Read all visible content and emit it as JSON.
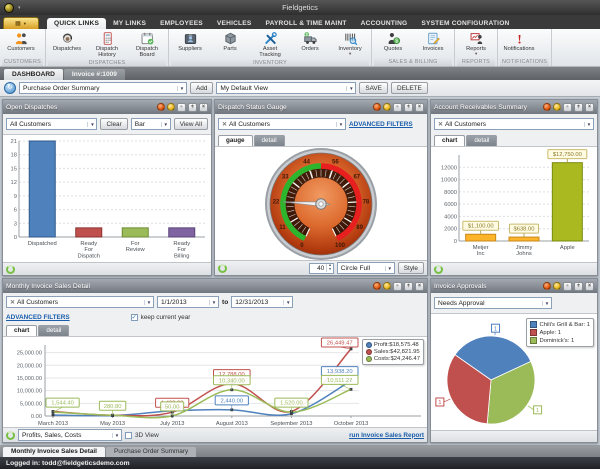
{
  "window": {
    "title": "Fieldgetics"
  },
  "ribbon": {
    "tabs": [
      {
        "label": "QUICK LINKS",
        "active": true
      },
      {
        "label": "MY LINKS"
      },
      {
        "label": "EMPLOYEES"
      },
      {
        "label": "VEHICLES"
      },
      {
        "label": "PAYROLL & TIME MAINT"
      },
      {
        "label": "ACCOUNTING"
      },
      {
        "label": "SYSTEM CONFIGURATION"
      }
    ],
    "groups": [
      {
        "label": "CUSTOMERS",
        "buttons": [
          {
            "label": "Customers",
            "icon": "customers-icon"
          }
        ]
      },
      {
        "label": "DISPATCHES",
        "buttons": [
          {
            "label": "Dispatches",
            "icon": "dispatches-icon"
          },
          {
            "label": "Dispatch History",
            "icon": "dispatch-history-icon"
          },
          {
            "label": "Dispatch Board",
            "icon": "dispatch-board-icon"
          }
        ]
      },
      {
        "label": "INVENTORY",
        "buttons": [
          {
            "label": "Suppliers",
            "icon": "suppliers-icon"
          },
          {
            "label": "Parts",
            "icon": "parts-icon"
          },
          {
            "label": "Asset Tracking",
            "icon": "asset-tracking-icon"
          },
          {
            "label": "Orders",
            "icon": "orders-icon"
          },
          {
            "label": "Inventory",
            "icon": "inventory-icon",
            "menu": true
          }
        ]
      },
      {
        "label": "SALES & BILLING",
        "buttons": [
          {
            "label": "Quotes",
            "icon": "quotes-icon"
          },
          {
            "label": "Invoices",
            "icon": "invoices-icon"
          }
        ]
      },
      {
        "label": "REPORTS",
        "buttons": [
          {
            "label": "Reports",
            "icon": "reports-icon",
            "menu": true
          }
        ]
      },
      {
        "label": "NOTIFICATIONS",
        "buttons": [
          {
            "label": "Notifications",
            "icon": "notifications-icon"
          }
        ]
      }
    ]
  },
  "doc_tabs": [
    {
      "label": "DASHBOARD",
      "active": true
    },
    {
      "label": "Invoice #:1009"
    }
  ],
  "dashboard_toolbar": {
    "view_select": "Purchase Order Summary",
    "add_label": "Add",
    "default_view_select": "My Default View",
    "save_label": "SAVE",
    "delete_label": "DELETE"
  },
  "panel_header_icons": [
    {
      "name": "refresh-icon"
    },
    {
      "name": "export-icon"
    },
    {
      "name": "collapse-icon"
    },
    {
      "name": "pin-icon"
    },
    {
      "name": "close-icon"
    }
  ],
  "panels": {
    "open_dispatches": {
      "title": "Open Dispatches",
      "customer_filter": "All Customers",
      "clear_label": "Clear",
      "chart_type_select": "Bar",
      "view_all_label": "View All"
    },
    "dispatch_gauge": {
      "title": "Dispatch Status Gauge",
      "customer_filter": "All Customers",
      "advanced_filters_label": "ADVANCED FILTERS",
      "tabs": [
        "gauge",
        "detail"
      ],
      "refresh_value": "40",
      "style_select": "Circle Full",
      "style_button": "Style"
    },
    "receivables": {
      "title": "Account Receivables Summary",
      "customer_filter": "All Customers",
      "tabs": [
        "chart",
        "detail"
      ]
    },
    "monthly_sales": {
      "title": "Monthly Invoice Sales Detail",
      "customer_filter": "All Customers",
      "date_from": "1/1/2013",
      "to_label": "to",
      "date_to": "12/31/2013",
      "advanced_filters_label": "ADVANCED FILTERS",
      "keep_current_year_label": "keep current year",
      "tabs": [
        "chart",
        "detail"
      ],
      "series_select": "Profits, Sales, Costs",
      "threed_label": "3D View",
      "report_link": "run Invoice Sales Report"
    },
    "approvals": {
      "title": "Invoice Approvals",
      "filter_select": "Needs Approval"
    }
  },
  "bottom_tabs": [
    {
      "label": "Monthly Invoice Sales Detail",
      "active": true
    },
    {
      "label": "Purchase Order Summary"
    }
  ],
  "status_bar": {
    "text": "Logged in: todd@fieldgeticsdemo.com"
  },
  "chart_data": [
    {
      "id": "open-dispatches",
      "type": "bar",
      "title": "Open Dispatches",
      "categories": [
        "Dispatched",
        "Ready For Dispatch",
        "For Review",
        "Ready For Billing"
      ],
      "values": [
        21,
        2,
        2,
        2
      ],
      "colors": [
        "#4f81bd",
        "#c0504d",
        "#9bbb59",
        "#8064a2"
      ],
      "stroke_colors": [
        "#2f5a8a",
        "#8a3432",
        "#6d8a35",
        "#5a4478"
      ],
      "ylim": [
        0,
        21
      ],
      "yticks": [
        0,
        3,
        6,
        9,
        12,
        15,
        18,
        21
      ]
    },
    {
      "id": "dispatch-gauge",
      "type": "gauge",
      "title": "Dispatch Status Gauge",
      "value": 22,
      "min": 0,
      "max": 100,
      "tick_labels": [
        0,
        11,
        22,
        33,
        44,
        56,
        67,
        78,
        89,
        100
      ],
      "green_range": [
        0,
        50
      ],
      "red_range": [
        50,
        100
      ],
      "green_color": "#2db52d",
      "red_color": "#e81f1f"
    },
    {
      "id": "receivables",
      "type": "bar",
      "title": "Account Receivables Summary",
      "categories": [
        "Meijer Inc",
        "Jimmy Johns",
        "Apple"
      ],
      "values": [
        1100,
        638,
        12750
      ],
      "value_labels": [
        "$1,100.00",
        "$638.00",
        "$12,750.00"
      ],
      "colors": [
        "#fcb42b",
        "#fcb42b",
        "#aab91f"
      ],
      "stroke_colors": [
        "#c8881a",
        "#c8881a",
        "#7a8a10"
      ],
      "ylim": [
        0,
        14000
      ],
      "yticks": [
        0,
        2000,
        4000,
        6000,
        8000,
        10000,
        12000
      ]
    },
    {
      "id": "monthly-sales",
      "type": "line",
      "title": "Monthly Invoice Sales Detail",
      "x_labels": [
        "March 2013",
        "May 2013",
        "July 2013",
        "August 2013",
        "September 2013",
        "October 2013"
      ],
      "ylim": [
        0,
        28000
      ],
      "yticks": [
        0,
        5000,
        10000,
        15000,
        20000,
        25000
      ],
      "ytick_labels": [
        "0.00",
        "5,000.00",
        "10,000.00",
        "15,000.00",
        "20,000.00",
        "25,000.00"
      ],
      "series": [
        {
          "name": "Profit",
          "color": "#4f81bd",
          "values": [
            400,
            150,
            2000,
            2440,
            900,
            13938.2
          ],
          "labels": {
            "3": "2,440.00",
            "5": "13,938.20"
          }
        },
        {
          "name": "Sales",
          "color": "#c0504d",
          "values": [
            1800,
            300,
            1499,
            12788,
            1800,
            26449.47
          ],
          "labels": {
            "2": "1,499.00",
            "3": "12,788.00",
            "5": "26,449.47"
          }
        },
        {
          "name": "Costs",
          "color": "#9bbb59",
          "values": [
            1544.4,
            280.8,
            50,
            10340,
            1520,
            10511.27
          ],
          "labels": {
            "0": "1,544.40",
            "1": "280.80",
            "2": "50.00",
            "3": "10,340.00",
            "4": "1,520.00",
            "5": "10,511.27"
          }
        }
      ],
      "legend": [
        "Profit:$18,575.48",
        "Sales:$42,821.95",
        "Costs:$24,246.47"
      ],
      "legend_position": "top-right"
    },
    {
      "id": "approvals-pie",
      "type": "pie",
      "title": "Invoice Approvals",
      "slices": [
        {
          "label": "Chili's Grill & Bar: 1",
          "value": 1,
          "color": "#4f81bd",
          "point_label": "1"
        },
        {
          "label": "Apple: 1",
          "value": 1,
          "color": "#c0504d",
          "point_label": "1"
        },
        {
          "label": "Dominick's: 1",
          "value": 1,
          "color": "#9bbb59",
          "point_label": "1"
        }
      ],
      "legend_position": "top-right"
    }
  ]
}
